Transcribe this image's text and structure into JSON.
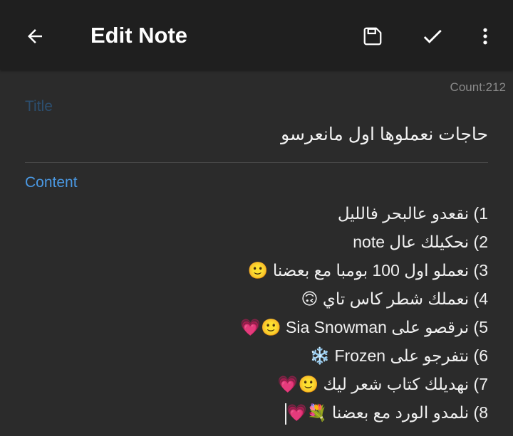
{
  "appbar": {
    "title": "Edit Note",
    "back_icon": "arrow-back-icon",
    "save_icon": "save-icon",
    "check_icon": "check-icon",
    "more_icon": "more-vert-icon",
    "background": "#1f1f1f"
  },
  "editor": {
    "count": "Count:212",
    "title_label": "Title",
    "title_value": "حاجات نعملوها اول مانعرسو",
    "content_label": "Content",
    "content_lines": [
      "1) نقعدو عالبحر فالليل",
      "2) نحكيلك عال note",
      "3) نعملو اول 100 بومبا مع بعضنا 🙂",
      "4) نعملك شطر كاس تاي 🙃",
      "5) نرقصو على Sia Snowman 🙂💗",
      "6) نتفرجو على Frozen ❄️",
      "7) نهديلك كتاب شعر ليك 🙂💗",
      "8) نلمدو الورد مع بعضنا 💐💗"
    ],
    "accent": "#4a98e2",
    "background": "#2b2b2b"
  }
}
